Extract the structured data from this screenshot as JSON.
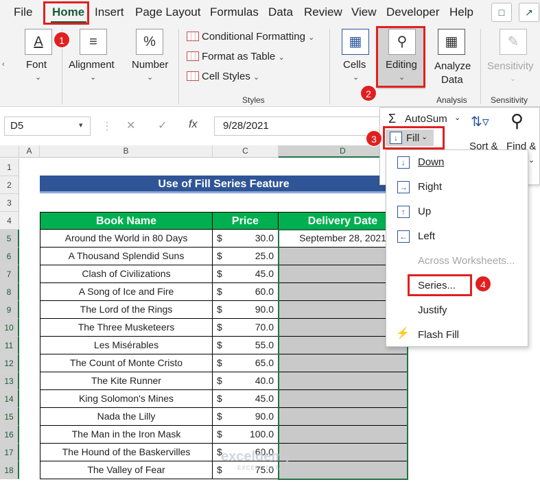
{
  "tabs": [
    "File",
    "Home",
    "Insert",
    "Page Layout",
    "Formulas",
    "Data",
    "Review",
    "View",
    "Developer",
    "Help"
  ],
  "ribbon": {
    "font": "Font",
    "alignment": "Alignment",
    "number": "Number",
    "conditional_formatting": "Conditional Formatting",
    "format_as_table": "Format as Table",
    "cell_styles": "Cell Styles",
    "styles_group": "Styles",
    "cells": "Cells",
    "editing": "Editing",
    "analyze_data_line1": "Analyze",
    "analyze_data_line2": "Data",
    "analysis_group": "Analysis",
    "sensitivity": "Sensitivity",
    "sensitivity_group": "Sensitivity"
  },
  "formula_bar": {
    "name_box": "D5",
    "fx": "fx",
    "value": "9/28/2021"
  },
  "columns": [
    "A",
    "B",
    "C",
    "D"
  ],
  "rows": [
    "1",
    "2",
    "3",
    "4",
    "5",
    "6",
    "7",
    "8",
    "9",
    "10",
    "11",
    "12",
    "13",
    "14",
    "15",
    "16",
    "17",
    "18"
  ],
  "sheet": {
    "title": "Use of Fill Series Feature",
    "headers": [
      "Book Name",
      "Price",
      "Delivery Date"
    ],
    "currency": "$",
    "books": [
      {
        "name": "Around the World in 80 Days",
        "price": "30.0",
        "date": "September 28, 2021"
      },
      {
        "name": "A Thousand Splendid Suns",
        "price": "25.0",
        "date": ""
      },
      {
        "name": "Clash of Civilizations",
        "price": "45.0",
        "date": ""
      },
      {
        "name": "A Song of Ice and Fire",
        "price": "60.0",
        "date": ""
      },
      {
        "name": "The Lord of the Rings",
        "price": "90.0",
        "date": ""
      },
      {
        "name": "The Three Musketeers",
        "price": "70.0",
        "date": ""
      },
      {
        "name": "Les Misérables",
        "price": "55.0",
        "date": ""
      },
      {
        "name": "The Count of Monte Cristo",
        "price": "65.0",
        "date": ""
      },
      {
        "name": "The Kite Runner",
        "price": "40.0",
        "date": ""
      },
      {
        "name": "King Solomon's Mines",
        "price": "45.0",
        "date": ""
      },
      {
        "name": "Nada the Lilly",
        "price": "90.0",
        "date": ""
      },
      {
        "name": "The Man in the Iron Mask",
        "price": "100.0",
        "date": ""
      },
      {
        "name": "The Hound of the Baskervilles",
        "price": "60.0",
        "date": ""
      },
      {
        "name": "The Valley of Fear",
        "price": "75.0",
        "date": ""
      }
    ]
  },
  "editing_menu": {
    "autosum": "AutoSum",
    "fill": "Fill",
    "sort_filter": "Sort &",
    "find_select": "Find &"
  },
  "fill_menu": [
    "Down",
    "Right",
    "Up",
    "Left",
    "Across Worksheets...",
    "Series...",
    "Justify",
    "Flash Fill"
  ],
  "badges": [
    "1",
    "2",
    "3",
    "4"
  ],
  "watermark": {
    "brand": "exceldemy",
    "tagline": "EXCEL · DATA · BI"
  },
  "colors": {
    "accent_green": "#217346",
    "title_blue": "#2f5597",
    "header_green": "#00b050",
    "highlight_red": "#e02020",
    "selected_gray": "#c9c9c9"
  }
}
